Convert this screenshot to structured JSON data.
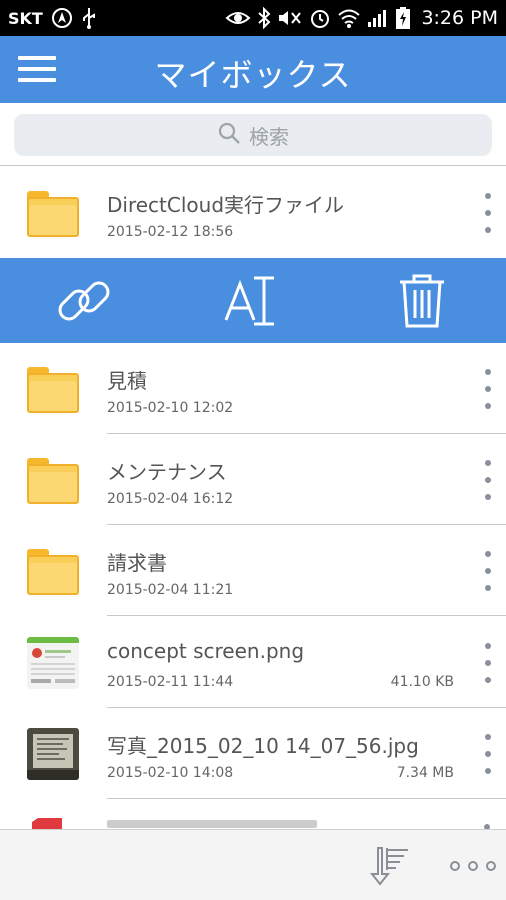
{
  "status_bar": {
    "carrier": "SKT",
    "time": "3:26 PM"
  },
  "app_bar": {
    "title": "マイボックス"
  },
  "search": {
    "placeholder": "検索"
  },
  "files": [
    {
      "name": "DirectCloud実行ファイル",
      "date": "2015-02-12 18:56",
      "size": "",
      "type": "folder"
    },
    {
      "name": "見積",
      "date": "2015-02-10 12:02",
      "size": "",
      "type": "folder"
    },
    {
      "name": "メンテナンス",
      "date": "2015-02-04 16:12",
      "size": "",
      "type": "folder"
    },
    {
      "name": "請求書",
      "date": "2015-02-04 11:21",
      "size": "",
      "type": "folder"
    },
    {
      "name": "concept screen.png",
      "date": "2015-02-11 11:44",
      "size": "41.10 KB",
      "type": "image"
    },
    {
      "name": "写真_2015_02_10 14_07_56.jpg",
      "date": "2015-02-10 14:08",
      "size": "7.34 MB",
      "type": "photo"
    }
  ],
  "colors": {
    "app_bar": "#4a8fdf",
    "folder": "#f9cf5a",
    "pdf": "#e0393e"
  },
  "actions": {
    "icons": [
      "link-icon",
      "rename-icon",
      "trash-icon"
    ]
  }
}
